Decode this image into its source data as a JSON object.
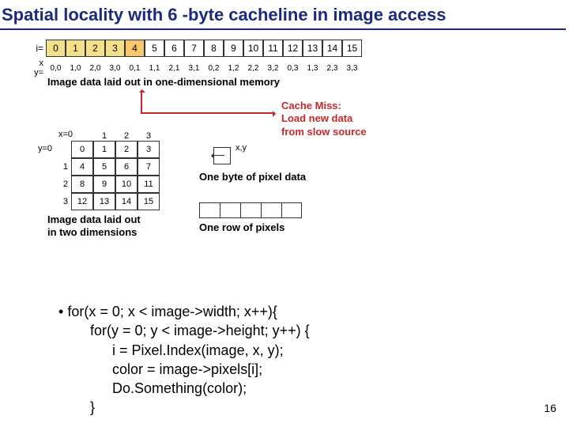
{
  "title": "Spatial locality with 6 -byte cacheline in image access",
  "top1d": {
    "i_label": "i=",
    "xy_label": "x y=",
    "i": [
      "0",
      "1",
      "2",
      "3",
      "4",
      "5",
      "6",
      "7",
      "8",
      "9",
      "10",
      "11",
      "12",
      "13",
      "14",
      "15"
    ],
    "highlight0": [
      0,
      1,
      2,
      3
    ],
    "highlight1": [
      4
    ],
    "xy": [
      "0,0",
      "1,0",
      "2,0",
      "3,0",
      "0,1",
      "1,1",
      "2,1",
      "3,1",
      "0,2",
      "1,2",
      "2,2",
      "3,2",
      "0,3",
      "1,3",
      "2,3",
      "3,3"
    ],
    "caption": "Image data laid out in one-dimensional memory"
  },
  "miss": {
    "l1": "Cache Miss:",
    "l2": "Load new data",
    "l3": "from slow source"
  },
  "grid2d": {
    "x_hdr": "x=0",
    "y_hdr": "y=0",
    "cols": [
      "",
      "1",
      "2",
      "3"
    ],
    "rows": [
      {
        "y": "",
        "cells": [
          "0",
          "1",
          "2",
          "3"
        ]
      },
      {
        "y": "1",
        "cells": [
          "4",
          "5",
          "6",
          "7"
        ]
      },
      {
        "y": "2",
        "cells": [
          "8",
          "9",
          "10",
          "11"
        ]
      },
      {
        "y": "3",
        "cells": [
          "12",
          "13",
          "14",
          "15"
        ]
      }
    ],
    "caption_l1": "Image data laid out",
    "caption_l2": "in two dimensions"
  },
  "pixel": {
    "coord_lab": "x,y",
    "caption": "One byte of pixel data"
  },
  "rowpix": {
    "caption": "One row of pixels",
    "count": 5
  },
  "code": {
    "l1": "for(x = 0; x < image->width; x++){",
    "l2": "for(y = 0; y < image->height; y++) {",
    "l3": "i = Pixel.Index(image, x, y);",
    "l4": "color = image->pixels[i];",
    "l5": "Do.Something(color);",
    "l6": "}"
  },
  "page": "16"
}
